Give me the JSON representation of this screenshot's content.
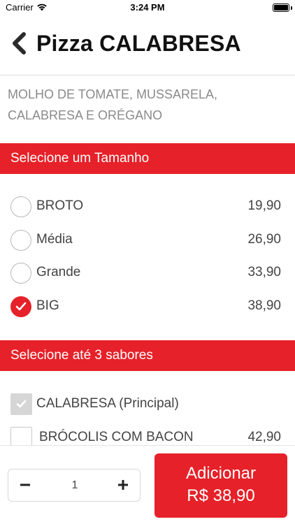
{
  "status_bar": {
    "carrier": "Carrier",
    "time": "3:24 PM"
  },
  "header": {
    "title": "Pizza CALABRESA"
  },
  "description": "MOLHO DE TOMATE, MUSSARELA, CALABRESA E ORÉGANO",
  "sizes_section": {
    "title": "Selecione um Tamanho",
    "options": [
      {
        "label": "BROTO",
        "price": "19,90",
        "selected": false
      },
      {
        "label": "Média",
        "price": "26,90",
        "selected": false
      },
      {
        "label": "Grande",
        "price": "33,90",
        "selected": false
      },
      {
        "label": "BIG",
        "price": "38,90",
        "selected": true
      }
    ]
  },
  "flavors_section": {
    "title": "Selecione até 3 sabores",
    "options": [
      {
        "label": "CALABRESA (Principal)",
        "price": "",
        "checked": true,
        "disabled": true
      },
      {
        "label": "BRÓCOLIS COM BACON",
        "price": "42,90",
        "checked": false,
        "disabled": false
      }
    ]
  },
  "footer": {
    "quantity": "1",
    "add_label": "Adicionar",
    "add_price": "R$ 38,90"
  },
  "colors": {
    "accent": "#e62129",
    "muted_text": "#8a8a8a"
  }
}
